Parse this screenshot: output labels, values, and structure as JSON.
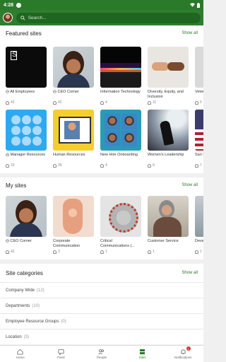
{
  "status": {
    "time": "4:28"
  },
  "search": {
    "placeholder": "Search..."
  },
  "featured": {
    "title": "Featured sites",
    "show_all": "Show all",
    "row1": [
      {
        "title": "All Employees",
        "members": "42",
        "thumb": "black-logo"
      },
      {
        "title": "CEO Corner",
        "members": "42",
        "thumb": "woman-portrait"
      },
      {
        "title": "Information Technology",
        "members": "4",
        "thumb": "tech-keyboard"
      },
      {
        "title": "Diversity, Equity, and Inclusion",
        "members": "11",
        "thumb": "hands"
      },
      {
        "title": "Veterans",
        "members": "5",
        "thumb": "blank"
      }
    ],
    "row2": [
      {
        "title": "Manager Resources",
        "members": "19",
        "thumb": "circles"
      },
      {
        "title": "Human Resources",
        "members": "39",
        "thumb": "yellow-frame"
      },
      {
        "title": "New Hire Onboarding",
        "members": "4",
        "thumb": "faces-grid"
      },
      {
        "title": "Women's Leadership",
        "members": "8",
        "thumb": "dance"
      },
      {
        "title": "San Fra",
        "members": "7",
        "thumb": "flag"
      }
    ]
  },
  "my_sites": {
    "title": "My sites",
    "show_all": "Show all",
    "items": [
      {
        "title": "CEO Corner",
        "members": "42",
        "thumb": "woman-portrait"
      },
      {
        "title": "Corporate Communication",
        "members": "3",
        "thumb": "pipe"
      },
      {
        "title": "Critical Communications (...",
        "members": "1",
        "thumb": "virus"
      },
      {
        "title": "Customer Service",
        "members": "1",
        "thumb": "service"
      },
      {
        "title": "Devel Resou",
        "members": "1",
        "thumb": "dev"
      }
    ]
  },
  "categories": {
    "title": "Site categories",
    "show_all": "Show all",
    "items": [
      {
        "label": "Company Wide",
        "count": "(12)"
      },
      {
        "label": "Departments",
        "count": "(10)"
      },
      {
        "label": "Employee Resource Groups",
        "count": "(0)"
      },
      {
        "label": "Location",
        "count": "(3)"
      }
    ]
  },
  "nav": {
    "home": "Home",
    "feed": "Feed",
    "people": "People",
    "sites": "Sites",
    "notifications": "Notifications",
    "badge": "1"
  },
  "colors": {
    "brand": "#2f7d2f",
    "accent": "#2c7a2c"
  }
}
